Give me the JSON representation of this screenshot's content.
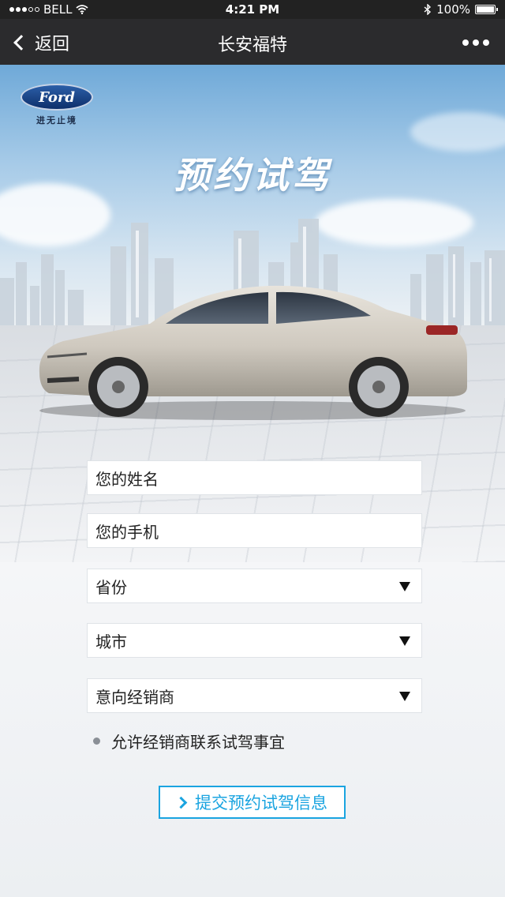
{
  "status_bar": {
    "carrier": "BELL",
    "time": "4:21 PM",
    "battery": "100%",
    "battery_level": 1.0
  },
  "nav": {
    "back_label": "返回",
    "title": "长安福特"
  },
  "brand": {
    "logo_text": "Ford",
    "slogan": "进无止境"
  },
  "hero": {
    "title": "预约试驾"
  },
  "form": {
    "name_placeholder": "您的姓名",
    "phone_placeholder": "您的手机",
    "province_label": "省份",
    "city_label": "城市",
    "dealer_label": "意向经销商",
    "consent_text": "允许经销商联系试驾事宜",
    "submit_label": "提交预约试驾信息"
  },
  "colors": {
    "accent": "#1aa4e0",
    "nav_bg": "#2b2b2d",
    "ford_blue": "#0d2f6b"
  },
  "icons": [
    "wifi-icon",
    "bluetooth-icon",
    "battery-icon",
    "back-chevron-icon",
    "more-icon",
    "caret-down-icon",
    "chevron-right-icon"
  ]
}
